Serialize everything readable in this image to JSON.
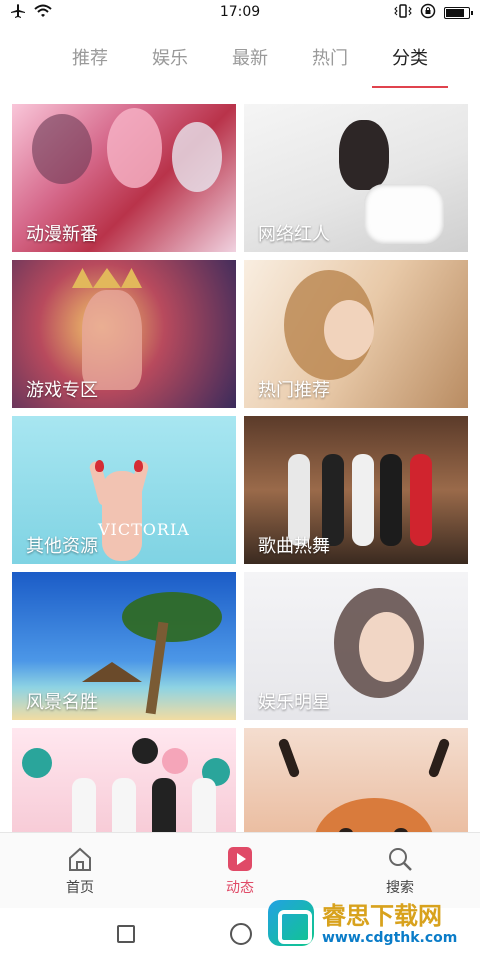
{
  "status_bar": {
    "time": "17:09",
    "battery_level": 0.85
  },
  "tabs": [
    {
      "label": "推荐",
      "active": false
    },
    {
      "label": "娱乐",
      "active": false
    },
    {
      "label": "最新",
      "active": false
    },
    {
      "label": "热门",
      "active": false
    },
    {
      "label": "分类",
      "active": true
    }
  ],
  "categories": [
    {
      "label": "动漫新番"
    },
    {
      "label": "网络红人"
    },
    {
      "label": "游戏专区"
    },
    {
      "label": "热门推荐"
    },
    {
      "label": "其他资源"
    },
    {
      "label": "歌曲热舞"
    },
    {
      "label": "风景名胜"
    },
    {
      "label": "娱乐明星"
    },
    {
      "label": ""
    },
    {
      "label": ""
    }
  ],
  "bottom_nav": [
    {
      "label": "首页",
      "icon": "home-icon",
      "active": false
    },
    {
      "label": "动态",
      "icon": "play-icon",
      "active": true
    },
    {
      "label": "搜索",
      "icon": "search-icon",
      "active": false
    }
  ],
  "colors": {
    "accent": "#e0434d",
    "active_nav": "#e04a67",
    "inactive_tab": "#9a9a9a"
  },
  "artwork_text": {
    "victoria": "VICTORIA"
  },
  "watermark": {
    "title": "睿思下载网",
    "url": "www.cdgthk.com"
  }
}
